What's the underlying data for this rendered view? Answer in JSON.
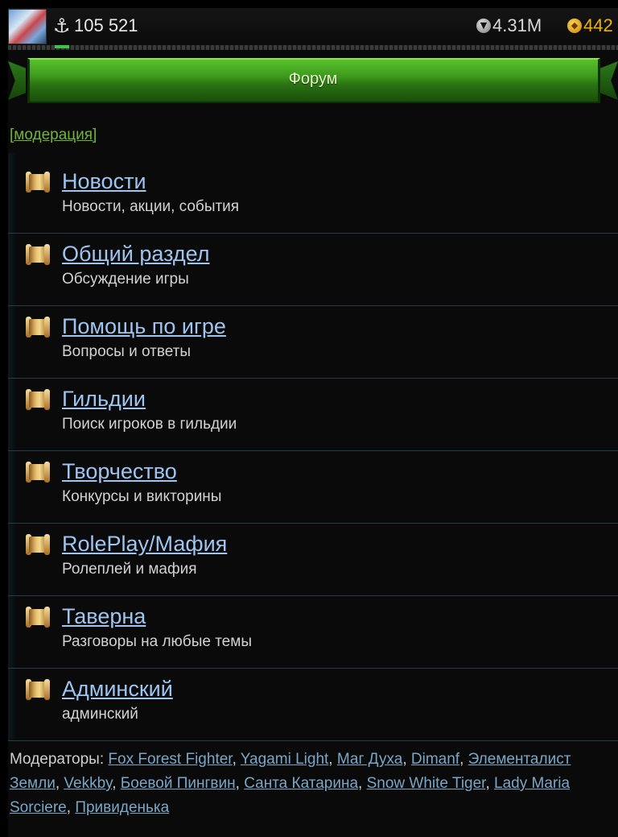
{
  "topbar": {
    "avatar_icon": "hero-avatar",
    "power_icon": "anchor-icon",
    "power_value": "105 521",
    "silver_icon": "silver-coin-icon",
    "silver_value": "4.31M",
    "gold_icon": "gold-coin-icon",
    "gold_value": "442",
    "silver_color": "#d8d8d8",
    "gold_color": "#f0b400"
  },
  "header": {
    "title": "Форум",
    "accent": "#3d9a1c"
  },
  "moderation_link": "[модерация]",
  "forums": [
    {
      "title": "Новости",
      "description": "Новости, акции, события"
    },
    {
      "title": "Общий раздел",
      "description": "Обсуждение игры"
    },
    {
      "title": "Помощь по игре",
      "description": "Вопросы и ответы"
    },
    {
      "title": "Гильдии",
      "description": "Поиск игроков в гильдии"
    },
    {
      "title": "Творчество",
      "description": "Конкурсы и викторины"
    },
    {
      "title": "RolePlay/Мафия",
      "description": "Ролеплей и мафия"
    },
    {
      "title": "Таверна",
      "description": "Разговоры на любые темы"
    },
    {
      "title": "Админский",
      "description": "админский"
    }
  ],
  "moderators": {
    "label": "Модераторы:",
    "names": [
      "Fox Forest Fighter",
      "Yagami Light",
      "Маг Духа",
      "Dimanf",
      "Элементалист Земли",
      "Vekkby",
      "Боевой Пингвин",
      "Санта Катарина",
      "Snow White Tiger",
      "Lady Maria Sorciere",
      "Привиденька"
    ]
  }
}
